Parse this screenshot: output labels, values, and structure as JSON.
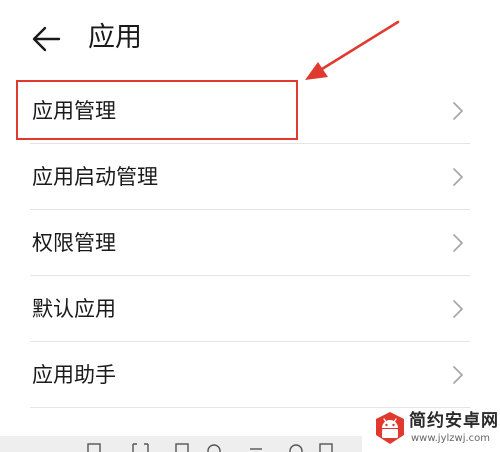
{
  "header": {
    "back_icon": "arrow-left-icon",
    "title": "应用"
  },
  "menu": {
    "items": [
      {
        "label": "应用管理",
        "highlighted": true
      },
      {
        "label": "应用启动管理"
      },
      {
        "label": "权限管理"
      },
      {
        "label": "默认应用"
      },
      {
        "label": "应用助手"
      }
    ],
    "chevron_icon": "chevron-right-icon"
  },
  "annotation": {
    "color": "#e03a2f",
    "type": "arrow-and-box"
  },
  "watermark": {
    "title": "简约安卓网",
    "url": "www.jylzwj.com",
    "logo_icon": "android-robot-logo",
    "logo_color": "#e03a2f"
  }
}
